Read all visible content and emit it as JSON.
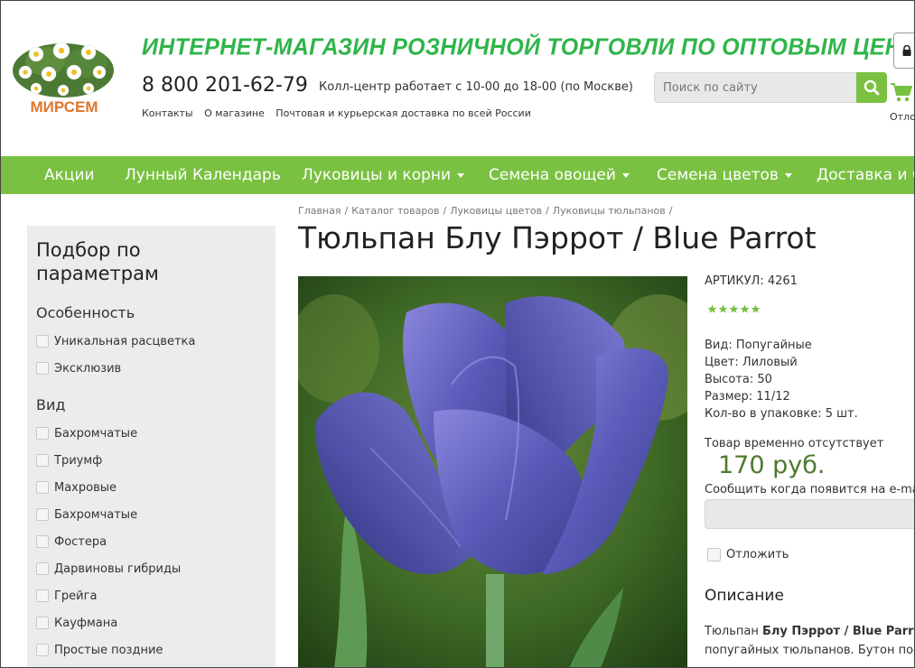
{
  "header": {
    "logo_text": "МИРСЕМ",
    "title": "ИНТЕРНЕТ-МАГАЗИН РОЗНИЧНОЙ ТОРГОВЛИ ПО ОПТОВЫМ ЦЕНАМ",
    "phone": "8 800 201-62-79",
    "call_center": "Колл-центр работает с 10-00 до 18-00 (по Москве)",
    "links": [
      "Контакты",
      "О магазине",
      "Почтовая и курьерская доставка по всей России"
    ],
    "search_placeholder": "Поиск по сайту",
    "postpone_label": "Отлож"
  },
  "nav": {
    "items": [
      {
        "label": "Акции",
        "dropdown": false
      },
      {
        "label": "Лунный Календарь",
        "dropdown": false
      },
      {
        "label": "Луковицы и корни",
        "dropdown": true
      },
      {
        "label": "Семена овощей",
        "dropdown": true
      },
      {
        "label": "Семена цветов",
        "dropdown": true
      },
      {
        "label": "Доставка и О",
        "dropdown": false
      }
    ]
  },
  "breadcrumb": [
    "Главная",
    "Каталог товаров",
    "Луковицы цветов",
    "Луковицы тюльпанов"
  ],
  "product": {
    "title": "Тюльпан Блу Пэррот / Blue Parrot",
    "sku": "АРТИКУЛ: 4261",
    "rating": 5,
    "props": [
      "Вид: Попугайные",
      "Цвет: Лиловый",
      "Высота: 50",
      "Размер: 11/12",
      "Кол-во в упаковке: 5 шт."
    ],
    "availability": "Товар временно отсутствует",
    "price": "170 руб.",
    "notify_label": "Сообщить когда появится на e-mail",
    "postpone_label": "Отложить",
    "desc_title": "Описание",
    "desc_prefix": "Тюльпан ",
    "desc_bold": "Блу Пэррот / Blue Parrot",
    "desc_suffix": " -",
    "desc_line2": "попугайных тюльпанов. Бутон посте"
  },
  "sidebar": {
    "title": "Подбор по параметрам",
    "group1": "Особенность",
    "group1_items": [
      "Уникальная расцветка",
      "Эксклюзив"
    ],
    "group2": "Вид",
    "group2_items": [
      "Бахромчатые",
      "Триумф",
      "Махровые",
      "Бахромчатые",
      "Фостера",
      "Дарвиновы гибриды",
      "Грейга",
      "Кауфмана",
      "Простые поздние"
    ]
  },
  "colors": {
    "accent_green": "#7ac142",
    "title_green": "#2fb54a",
    "price_green": "#4d7a2e",
    "sidebar_bg": "#ebecec"
  }
}
